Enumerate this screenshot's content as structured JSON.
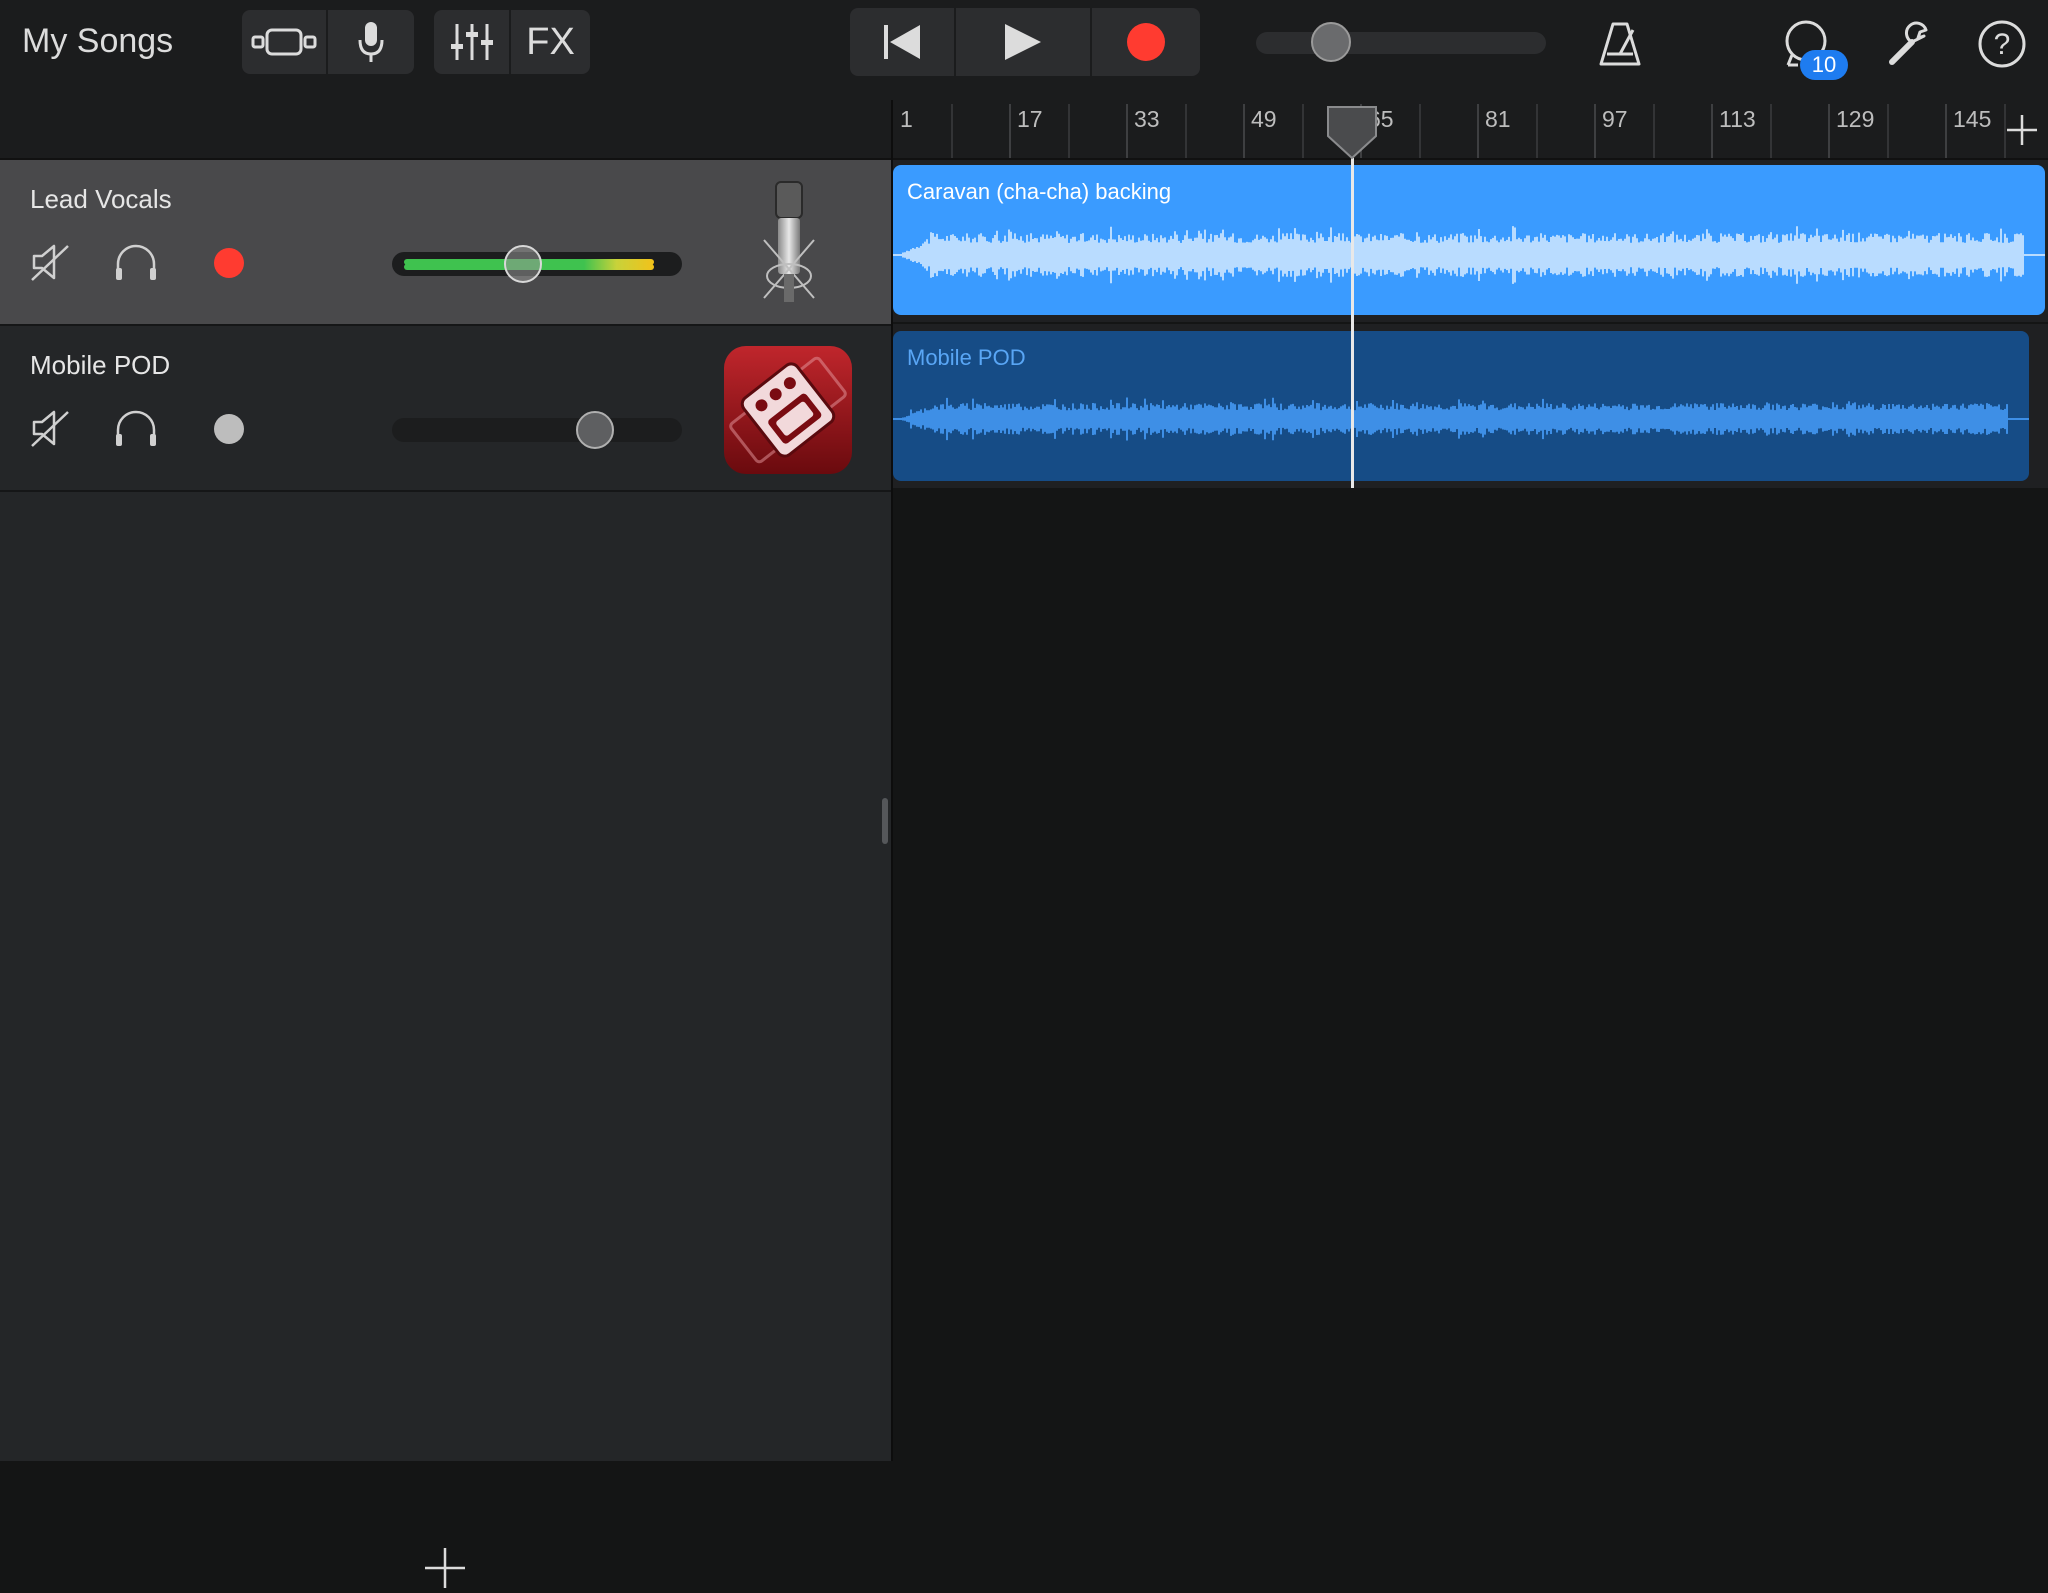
{
  "toolbar": {
    "my_songs_label": "My Songs",
    "fx_label": "FX",
    "help_label": "?",
    "notification_count": "10",
    "master_volume": 0.26
  },
  "ruler": {
    "bar_numbers": [
      "1",
      "17",
      "33",
      "49",
      "65",
      "81",
      "97",
      "113",
      "129",
      "145"
    ]
  },
  "tracks": [
    {
      "name": "Lead Vocals",
      "instrument": "microphone-icon",
      "record_armed": true,
      "volume": 0.45,
      "selected": true,
      "region_label": "Caravan (cha-cha) backing"
    },
    {
      "name": "Mobile POD",
      "instrument": "mobile-pod-amp-icon",
      "record_armed": false,
      "volume": 0.7,
      "selected": false,
      "region_label": "Mobile POD"
    }
  ],
  "colors": {
    "record_red": "#ff3b30",
    "region_selected": "#3a9bff",
    "region_unselected": "#164c86",
    "badge_blue": "#1e7cf0"
  }
}
